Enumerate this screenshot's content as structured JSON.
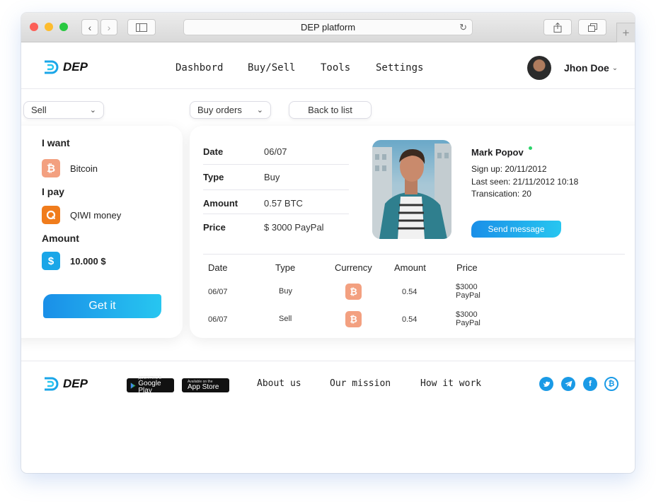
{
  "browser": {
    "title": "DEP platform"
  },
  "header": {
    "logo": "DEP",
    "nav": [
      "Dashbord",
      "Buy/Sell",
      "Tools",
      "Settings"
    ],
    "user_name": "Jhon Doe"
  },
  "controls": {
    "mode_select": "Sell",
    "orders_select": "Buy orders",
    "back_label": "Back to list"
  },
  "exchange": {
    "want_label": "I want",
    "want_value": "Bitcoin",
    "pay_label": "I pay",
    "pay_value": "QIWI money",
    "amount_label": "Amount",
    "amount_value": "10.000 $",
    "submit_label": "Get it"
  },
  "order": {
    "rows": [
      {
        "key": "Date",
        "value": "06/07"
      },
      {
        "key": "Type",
        "value": "Buy"
      },
      {
        "key": "Amount",
        "value": "0.57 BTC"
      },
      {
        "key": "Price",
        "value": "$ 3000 PayPal"
      }
    ]
  },
  "profile": {
    "name": "Mark Popov",
    "signup": "Sign up: 20/11/2012",
    "last_seen": "Last seen: 21/11/2012 10:18",
    "transactions": "Transication: 20",
    "message_label": "Send message"
  },
  "history": {
    "headers": [
      "Date",
      "Type",
      "Currency",
      "Amount",
      "Price"
    ],
    "rows": [
      {
        "date": "06/07",
        "type": "Buy",
        "currency_icon": "bitcoin-icon",
        "amount": "0.54",
        "price": "$3000",
        "method": "PayPal"
      },
      {
        "date": "06/07",
        "type": "Sell",
        "currency_icon": "bitcoin-icon",
        "amount": "0.54",
        "price": "$3000",
        "method": "PayPal"
      }
    ]
  },
  "footer": {
    "logo": "DEP",
    "google_small": "ДОСТУПНО В",
    "google_big": "Google Play",
    "apple_small": "Available on the",
    "apple_big": "App Store",
    "links": [
      "About us",
      "Our mission",
      "How it work"
    ],
    "social": [
      "twitter-icon",
      "telegram-icon",
      "facebook-icon",
      "bitcoin-icon"
    ]
  },
  "colors": {
    "accent": "#1a8fe8",
    "accent_light": "#27c6f0",
    "coin": "#f3a080",
    "qiwi": "#f07c1c",
    "dollar": "#1aa6e8",
    "online": "#2bd46a"
  }
}
